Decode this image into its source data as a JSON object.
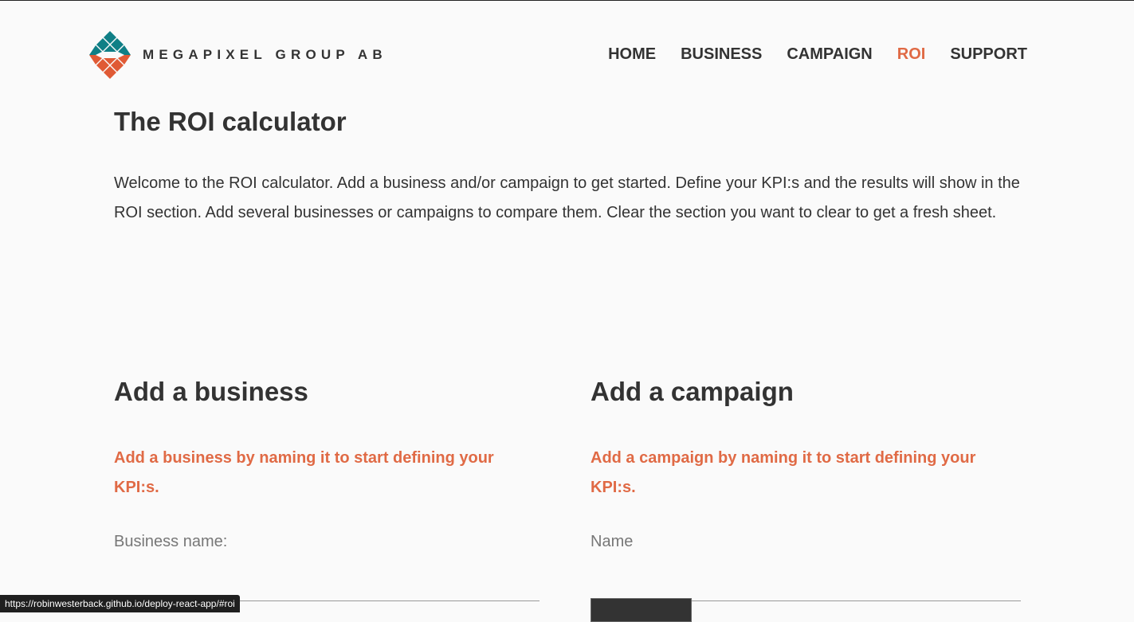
{
  "brand": {
    "name": "MEGAPIXEL GROUP AB",
    "colors": {
      "teal": "#0f7f86",
      "orange": "#e05a35",
      "text": "#333333"
    }
  },
  "nav": {
    "items": [
      {
        "label": "HOME",
        "active": false
      },
      {
        "label": "BUSINESS",
        "active": false
      },
      {
        "label": "CAMPAIGN",
        "active": false
      },
      {
        "label": "ROI",
        "active": true
      },
      {
        "label": "SUPPORT",
        "active": false
      }
    ],
    "active_color": "#e06a45"
  },
  "page": {
    "title": "The ROI calculator",
    "intro": "Welcome to the ROI calculator. Add a business and/or campaign to get started. Define your KPI:s and the results will show in the ROI section. Add several businesses or campaigns to compare them. Clear the section you want to clear to get a fresh sheet."
  },
  "business": {
    "heading": "Add a business",
    "hint": "Add a business by naming it to start defining your KPI:s.",
    "field_label": "Business name:",
    "value": ""
  },
  "campaign": {
    "heading": "Add a campaign",
    "hint": "Add a campaign by naming it to start defining your KPI:s.",
    "field_label": "Name",
    "value": ""
  },
  "status_bar": {
    "url": "https://robinwesterback.github.io/deploy-react-app/#roi"
  }
}
